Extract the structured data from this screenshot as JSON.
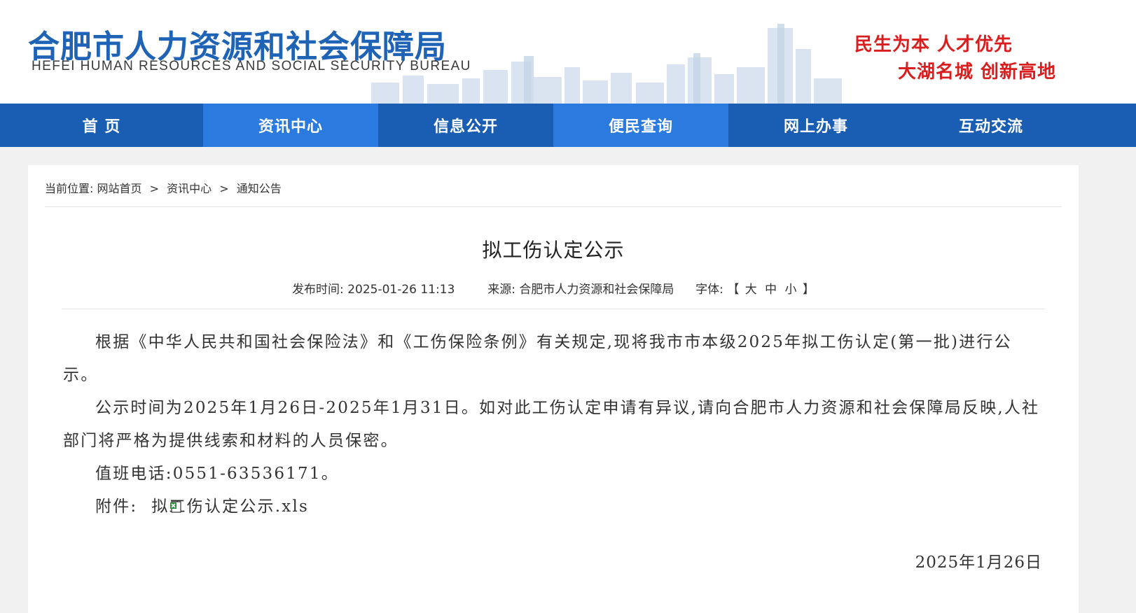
{
  "header": {
    "logo_cn": "合肥市人力资源和社会保障局",
    "logo_en": "HEFEI HUMAN RESOURCES AND SOCIAL SECURITY BUREAU",
    "slogan_line1": "民生为本  人才优先",
    "slogan_line2": "大湖名城  创新高地"
  },
  "nav": {
    "items": [
      {
        "label": "首 页"
      },
      {
        "label": "资讯中心"
      },
      {
        "label": "信息公开"
      },
      {
        "label": "便民查询"
      },
      {
        "label": "网上办事"
      },
      {
        "label": "互动交流"
      }
    ]
  },
  "breadcrumb": {
    "prefix": "当前位置:",
    "items": [
      "网站首页",
      "资讯中心",
      "通知公告"
    ],
    "separator": ">"
  },
  "article": {
    "title": "拟工伤认定公示",
    "publish_label": "发布时间:",
    "publish_time": "2025-01-26 11:13",
    "source_label": "来源:",
    "source": "合肥市人力资源和社会保障局",
    "font_label": "字体:",
    "font_open": "【",
    "font_large": "大",
    "font_medium": "中",
    "font_small": "小",
    "font_close": "】",
    "paragraphs": [
      "根据《中华人民共和国社会保险法》和《工伤保险条例》有关规定,现将我市市本级2025年拟工伤认定(第一批)进行公示。",
      "公示时间为2025年1月26日-2025年1月31日。如对此工伤认定申请有异议,请向合肥市人力资源和社会保障局反映,人社部门将严格为提供线索和材料的人员保密。",
      "值班电话:0551-63536171。"
    ],
    "attachment_label": "附件:",
    "attachment_name": "拟工伤认定公示.xls",
    "attachment_icon": "excel-file-icon",
    "date": "2025年1月26日"
  },
  "colors": {
    "brand_blue": "#1f63b6",
    "nav_blue": "#1a5eb4",
    "nav_highlight": "#2a7ae0",
    "slogan_red": "#d81e1e"
  }
}
